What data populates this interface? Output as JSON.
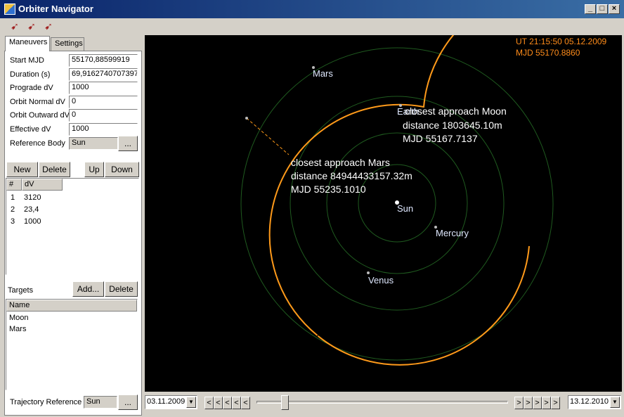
{
  "window": {
    "title": "Orbiter Navigator",
    "minimize_glyph": "_",
    "maximize_glyph": "□",
    "close_glyph": "×"
  },
  "toolbar": {
    "icon": "rocket-icon",
    "icon_color": "#a02020"
  },
  "tabs": [
    {
      "label": "Maneuvers",
      "active": true
    },
    {
      "label": "Settings",
      "active": false
    }
  ],
  "maneuver_form": {
    "start_mjd_label": "Start MJD",
    "start_mjd_value": "55170,88599919",
    "duration_label": "Duration (s)",
    "duration_value": "69,9162740707397",
    "prograde_label": "Prograde dV",
    "prograde_value": "1000",
    "orbit_normal_label": "Orbit Normal dV",
    "orbit_normal_value": "0",
    "orbit_outward_label": "Orbit Outward dV",
    "orbit_outward_value": "0",
    "effective_label": "Effective dV",
    "effective_value": "1000",
    "reference_body_label": "Reference Body",
    "reference_body_value": "Sun",
    "reference_body_browse": "..."
  },
  "maneuver_buttons": {
    "new": "New",
    "delete": "Delete",
    "up": "Up",
    "down": "Down"
  },
  "maneuver_list": {
    "columns": [
      "#",
      "dV"
    ],
    "rows": [
      {
        "num": "1",
        "dv": "3120"
      },
      {
        "num": "2",
        "dv": "23,4"
      },
      {
        "num": "3",
        "dv": "1000"
      }
    ]
  },
  "targets": {
    "label": "Targets",
    "add": "Add...",
    "delete": "Delete",
    "column": "Name",
    "rows": [
      "Moon",
      "Mars"
    ]
  },
  "trajectory": {
    "label": "Trajectory Reference",
    "value": "Sun",
    "browse": "..."
  },
  "view": {
    "ut_line": "UT    21:15:50 05.12.2009",
    "mjd_line": "MJD 55170.8860",
    "ut_color": "#ff8c1a",
    "trajectory_color": "#ff9a1a",
    "orbit_color": "#1f5a1f",
    "bodies": [
      "Mars",
      "Earth",
      "Sun",
      "Mercury",
      "Venus"
    ],
    "approach_moon": [
      "closest approach Moon",
      "distance 1803645.10m",
      "MJD 55167.7137"
    ],
    "approach_mars": [
      "closest approach Mars",
      "distance 84944433157.32m",
      "MJD 55235.1010"
    ]
  },
  "timeline": {
    "start_date": "03.11.2009",
    "end_date": "13.12.2010",
    "back_glyph": "<",
    "forward_glyph": ">",
    "position_fraction": 0.1
  }
}
